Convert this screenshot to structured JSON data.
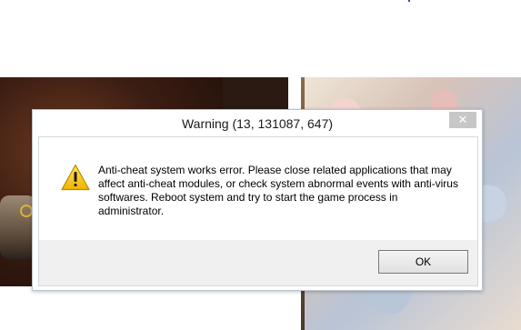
{
  "dialog": {
    "title": "Warning (13, 131087, 647)",
    "close_symbol": "✕",
    "icon": "warning-icon",
    "message": "Anti-cheat system works error. Please close related applications that may affect anti-cheat modules, or check system abnormal events with anti-virus softwares. Reboot system and try to start the game process in administrator.",
    "ok_label": "OK"
  },
  "colors": {
    "warning_fill": "#F5C400",
    "close_bg": "#C7C7C7",
    "footer_bg": "#F0F0F0"
  }
}
